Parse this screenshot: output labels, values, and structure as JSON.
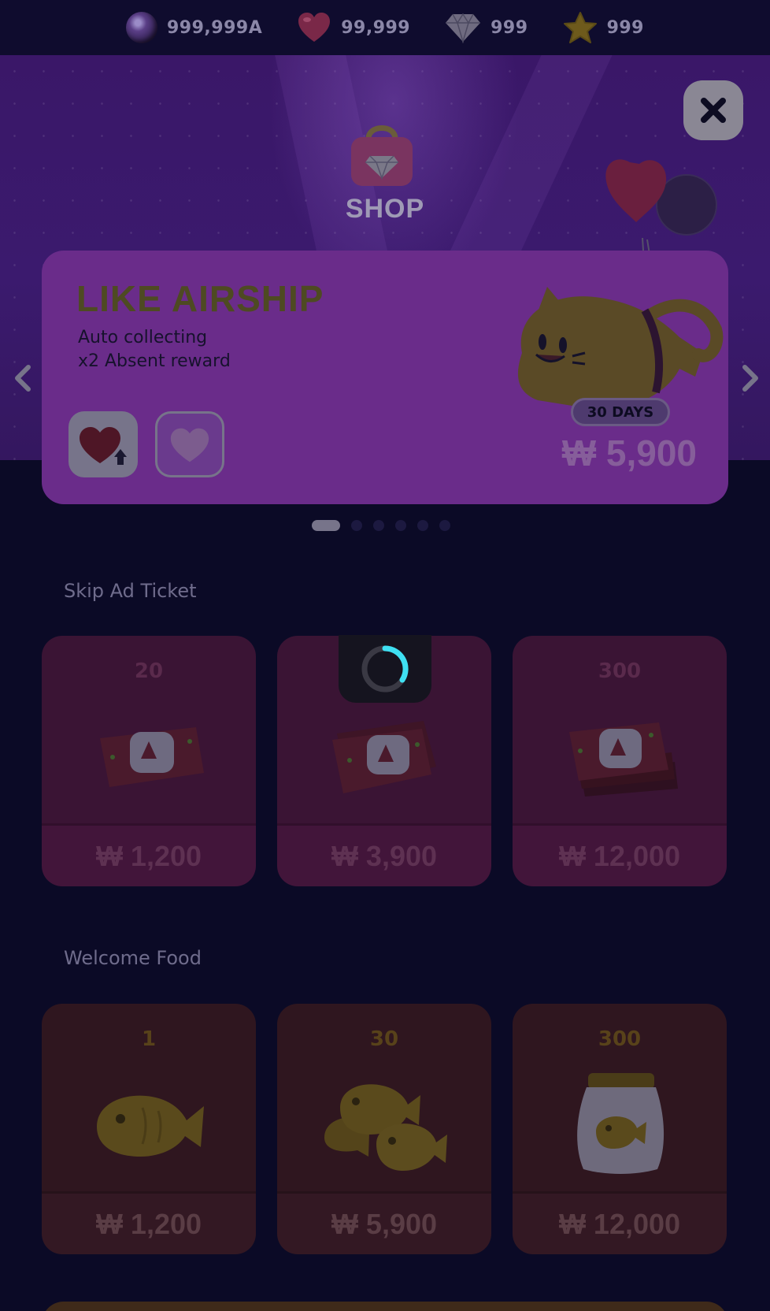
{
  "currencies": [
    {
      "icon": "orb-icon",
      "value": "999,999A"
    },
    {
      "icon": "heart-icon",
      "value": "99,999"
    },
    {
      "icon": "gem-icon",
      "value": "999"
    },
    {
      "icon": "star-icon",
      "value": "999"
    }
  ],
  "header": {
    "title": "SHOP"
  },
  "banner": {
    "title": "LIKE AIRSHIP",
    "desc_line1": "Auto collecting",
    "desc_line2": "x2 Absent reward",
    "badge": "30 DAYS",
    "price": "₩ 5,900",
    "page_count": 6,
    "active_page": 1
  },
  "sections": {
    "skip_ad": {
      "title": "Skip Ad Ticket",
      "items": [
        {
          "qty": "20",
          "price": "₩ 1,200"
        },
        {
          "qty": "",
          "price": "₩ 3,900"
        },
        {
          "qty": "300",
          "price": "₩ 12,000"
        }
      ]
    },
    "welcome_food": {
      "title": "Welcome Food",
      "items": [
        {
          "qty": "1",
          "price": "₩ 1,200"
        },
        {
          "qty": "30",
          "price": "₩ 5,900"
        },
        {
          "qty": "300",
          "price": "₩ 12,000"
        }
      ]
    }
  },
  "colors": {
    "spinner": "#3fe0f2",
    "background": "#0b0a26",
    "hero": "#3a1768"
  }
}
